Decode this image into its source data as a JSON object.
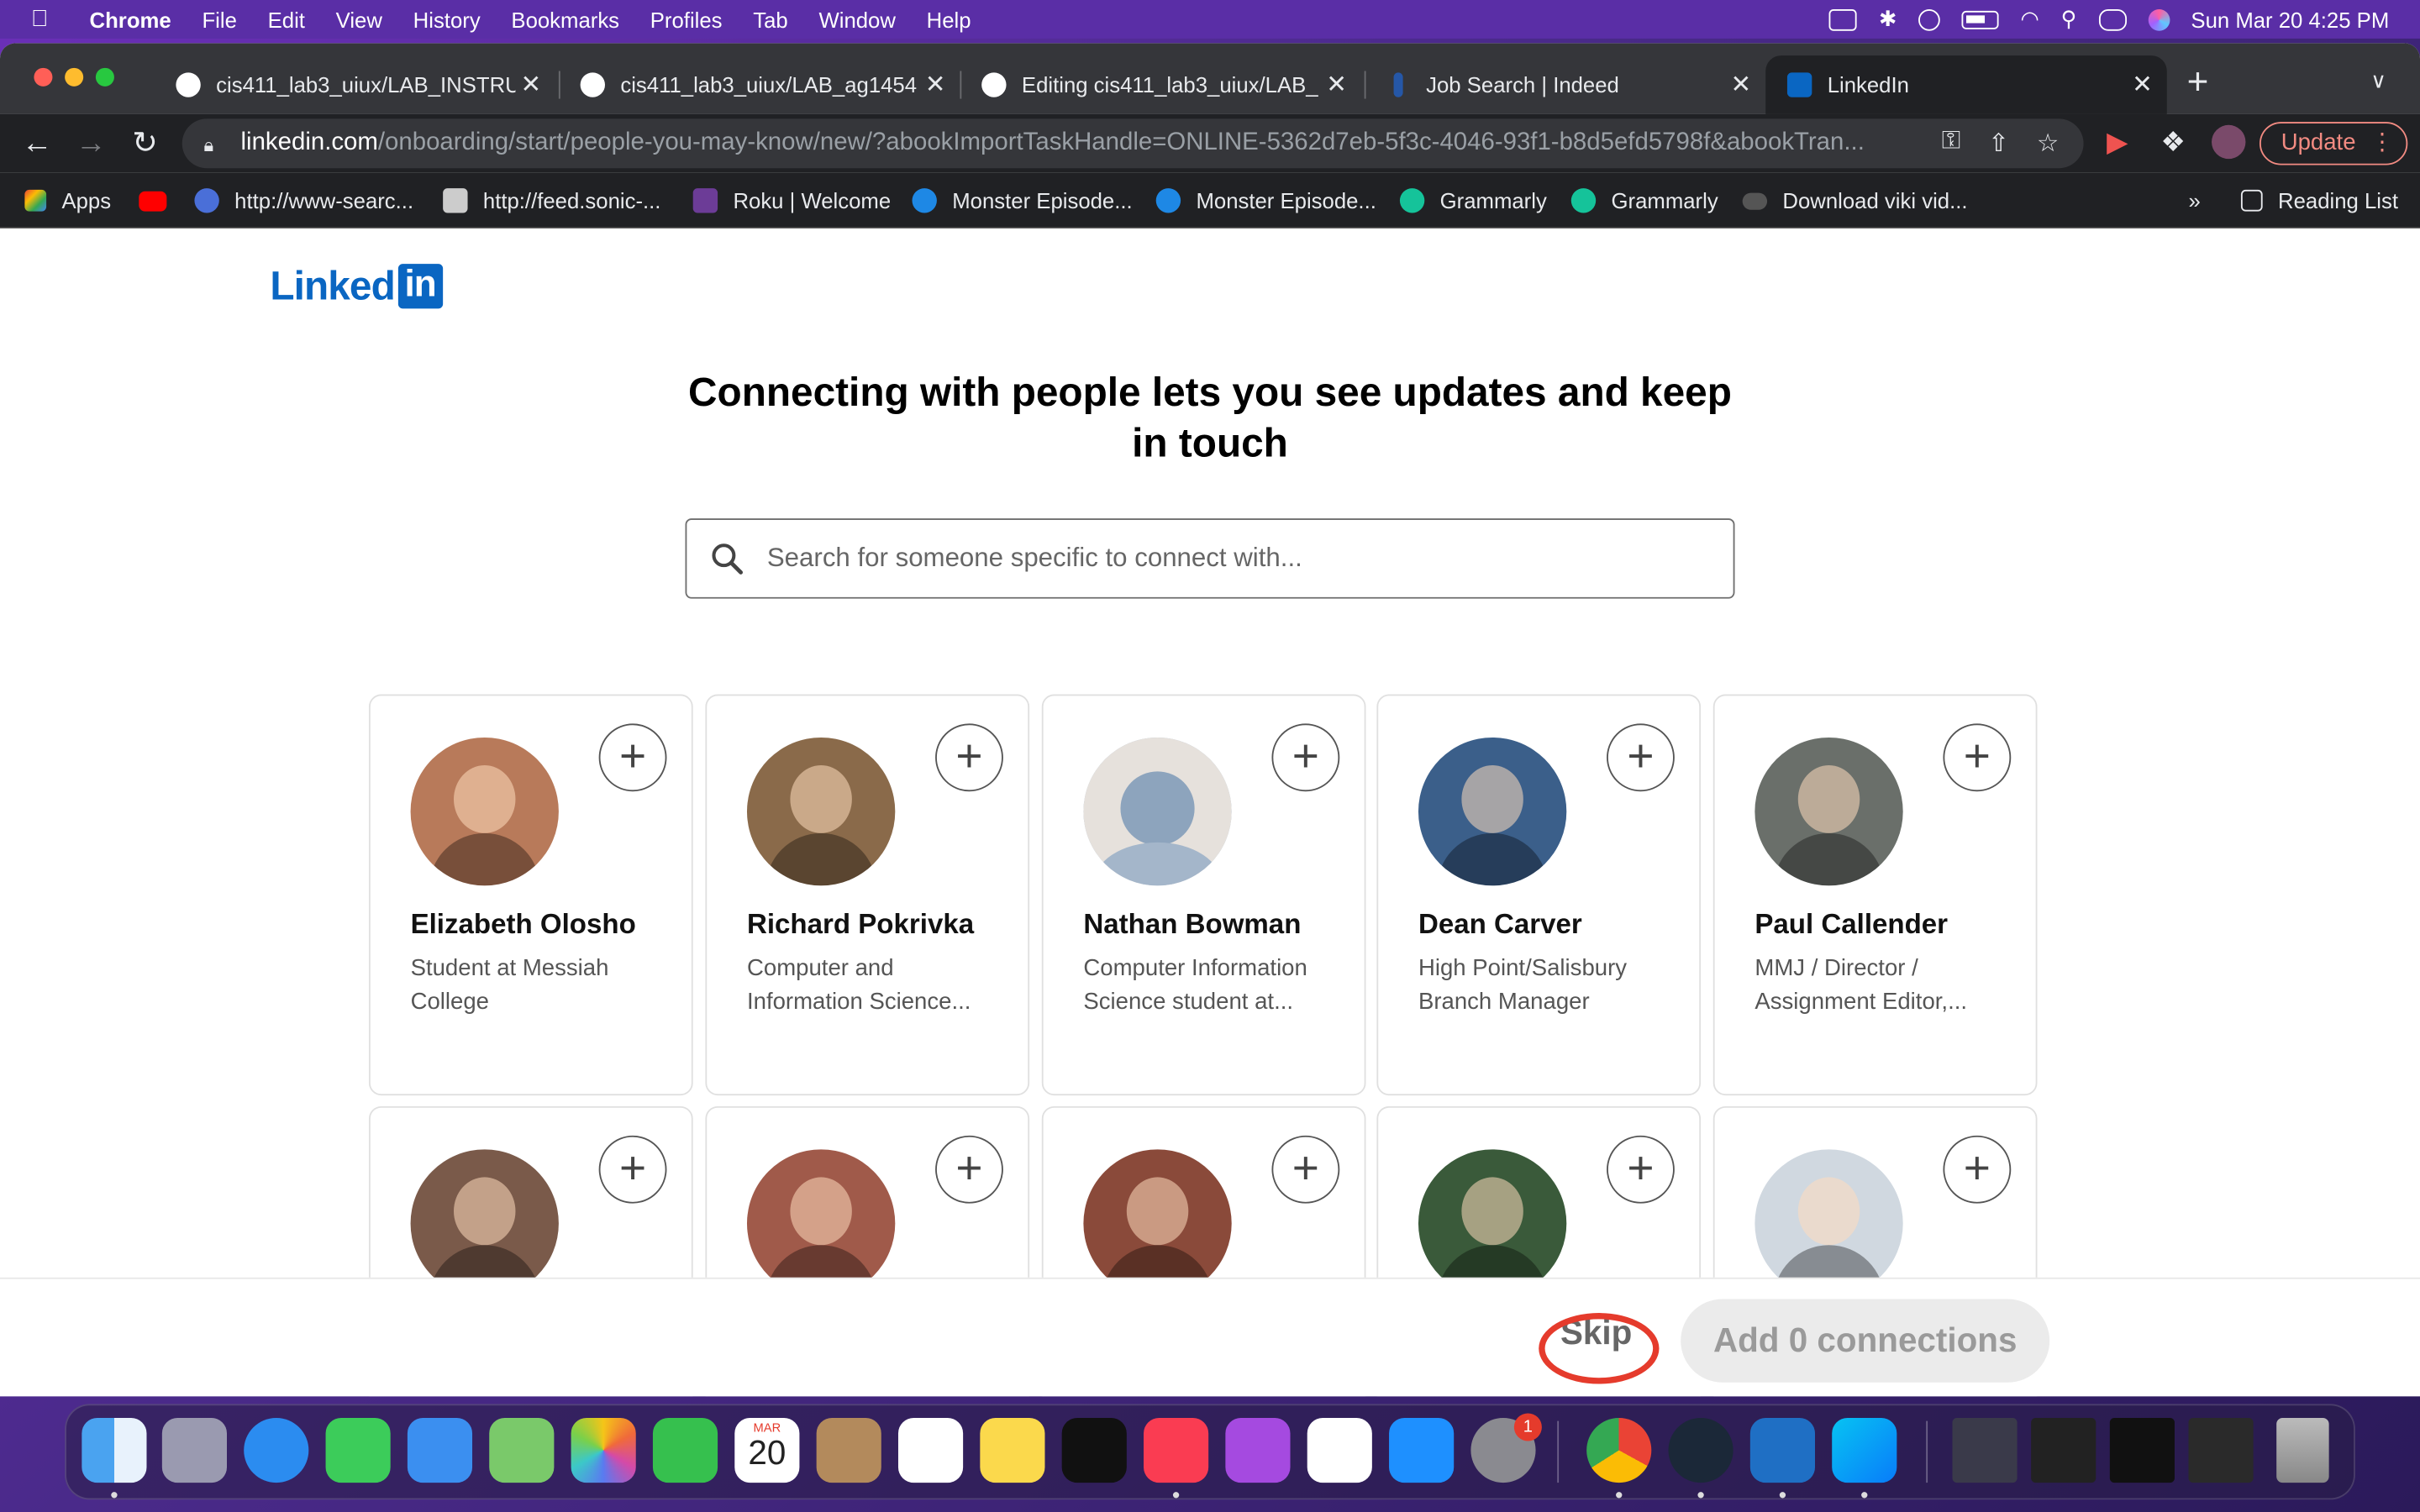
{
  "menubar": {
    "app": "Chrome",
    "items": [
      "File",
      "Edit",
      "View",
      "History",
      "Bookmarks",
      "Profiles",
      "Tab",
      "Window",
      "Help"
    ],
    "datetime": "Sun Mar 20  4:25 PM"
  },
  "tabs": [
    {
      "title": "cis411_lab3_uiux/LAB_INSTRU",
      "icon": "github-icon"
    },
    {
      "title": "cis411_lab3_uiux/LAB_ag1454",
      "icon": "github-icon"
    },
    {
      "title": "Editing cis411_lab3_uiux/LAB_",
      "icon": "github-icon"
    },
    {
      "title": "Job Search | Indeed",
      "icon": "indeed-icon"
    },
    {
      "title": "LinkedIn",
      "icon": "linkedin-icon"
    }
  ],
  "omnibox": {
    "host": "linkedin.com",
    "path": "/onboarding/start/people-you-may-know/new/?abookImportTaskHandle=ONLINE-5362d7eb-5f3c-4046-93f1-b8d5efd5798f&abookTran..."
  },
  "update_label": "Update",
  "bookmarks": [
    {
      "label": "Apps",
      "color": "#ea4335"
    },
    {
      "label": "",
      "color": "#ff0000"
    },
    {
      "label": "http://www-searc...",
      "color": "#4a6fd8"
    },
    {
      "label": "http://feed.sonic-...",
      "color": "#cccccc"
    },
    {
      "label": "Roku | Welcome",
      "color": "#6c3c97"
    },
    {
      "label": "Monster Episode...",
      "color": "#1e88e5"
    },
    {
      "label": "Monster Episode...",
      "color": "#1e88e5"
    },
    {
      "label": "Grammarly",
      "color": "#15c39a"
    },
    {
      "label": "Grammarly",
      "color": "#15c39a"
    },
    {
      "label": "Download viki vid...",
      "color": "#222222"
    }
  ],
  "bookmarks_more": "»",
  "reading_list": "Reading List",
  "linkedin": {
    "logo_text": "Linked",
    "logo_box": "in",
    "headline": "Connecting with people lets you see updates and keep in touch",
    "search_placeholder": "Search for someone specific to connect with...",
    "cards": [
      {
        "name": "Elizabeth Olosho",
        "headline": "Student at Messiah College",
        "avatar_color": "#b87a5a"
      },
      {
        "name": "Richard Pokrivka",
        "headline": "Computer and Information Science...",
        "avatar_color": "#8a6a4a"
      },
      {
        "name": "Nathan Bowman",
        "headline": "Computer Information Science student at...",
        "avatar_color": "#9fb2c8"
      },
      {
        "name": "Dean Carver",
        "headline": "High Point/Salisbury Branch Manager",
        "avatar_color": "#3b5f8a"
      },
      {
        "name": "Paul Callender",
        "headline": "MMJ / Director / Assignment Editor,...",
        "avatar_color": "#6a6f6a"
      },
      {
        "name": "",
        "headline": "",
        "avatar_color": "#7a5a4a"
      },
      {
        "name": "",
        "headline": "",
        "avatar_color": "#a05a4a"
      },
      {
        "name": "",
        "headline": "",
        "avatar_color": "#8a4a3a"
      },
      {
        "name": "",
        "headline": "",
        "avatar_color": "#3a5a3a"
      },
      {
        "name": "",
        "headline": "",
        "avatar_color": "#d0d8e0"
      }
    ],
    "add_symbol": "+",
    "skip_label": "Skip",
    "add_connections_label": "Add 0 connections"
  },
  "dock": {
    "calendar_month": "MAR",
    "calendar_day": "20",
    "settings_badge": "1"
  }
}
